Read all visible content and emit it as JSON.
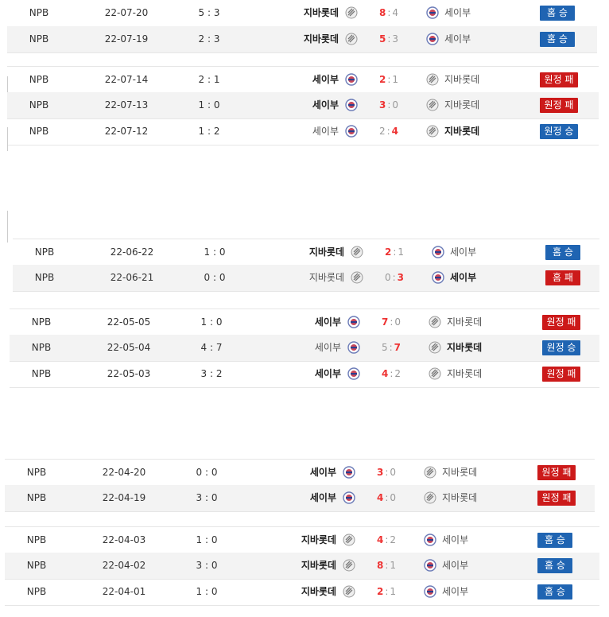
{
  "teams": {
    "lotte": "지바롯데",
    "seibu": "세이부"
  },
  "groups": [
    {
      "rows": [
        {
          "league": "NPB",
          "date": "22-07-20",
          "ht": "5 : 3",
          "home": "지바롯데",
          "away": "세이부",
          "hs": "8",
          "as": "4",
          "home_logo": "lotte",
          "away_logo": "seibu",
          "home_bold": true,
          "away_bold": false,
          "hs_win": true,
          "result": "홈 승",
          "result_kind": "home-win"
        },
        {
          "league": "NPB",
          "date": "22-07-19",
          "ht": "2 : 3",
          "home": "지바롯데",
          "away": "세이부",
          "hs": "5",
          "as": "3",
          "home_logo": "lotte",
          "away_logo": "seibu",
          "home_bold": true,
          "away_bold": false,
          "hs_win": true,
          "result": "홈 승",
          "result_kind": "home-win"
        }
      ]
    },
    {
      "rows": [
        {
          "league": "NPB",
          "date": "22-07-14",
          "ht": "2 : 1",
          "home": "세이부",
          "away": "지바롯데",
          "hs": "2",
          "as": "1",
          "home_logo": "seibu",
          "away_logo": "lotte",
          "home_bold": true,
          "away_bold": false,
          "hs_win": true,
          "result": "원정 패",
          "result_kind": "away-loss"
        },
        {
          "league": "NPB",
          "date": "22-07-13",
          "ht": "1 : 0",
          "home": "세이부",
          "away": "지바롯데",
          "hs": "3",
          "as": "0",
          "home_logo": "seibu",
          "away_logo": "lotte",
          "home_bold": true,
          "away_bold": false,
          "hs_win": true,
          "result": "원정 패",
          "result_kind": "away-loss"
        },
        {
          "league": "NPB",
          "date": "22-07-12",
          "ht": "1 : 2",
          "home": "세이부",
          "away": "지바롯데",
          "hs": "2",
          "as": "4",
          "home_logo": "seibu",
          "away_logo": "lotte",
          "home_bold": false,
          "away_bold": true,
          "hs_win": false,
          "result": "원정 승",
          "result_kind": "away-win"
        }
      ]
    },
    {
      "rows": [
        {
          "league": "NPB",
          "date": "22-06-22",
          "ht": "1 : 0",
          "home": "지바롯데",
          "away": "세이부",
          "hs": "2",
          "as": "1",
          "home_logo": "lotte",
          "away_logo": "seibu",
          "home_bold": true,
          "away_bold": false,
          "hs_win": true,
          "result": "홈 승",
          "result_kind": "home-win"
        },
        {
          "league": "NPB",
          "date": "22-06-21",
          "ht": "0 : 0",
          "home": "지바롯데",
          "away": "세이부",
          "hs": "0",
          "as": "3",
          "home_logo": "lotte",
          "away_logo": "seibu",
          "home_bold": false,
          "away_bold": true,
          "hs_win": false,
          "result": "홈 패",
          "result_kind": "home-loss"
        }
      ]
    },
    {
      "rows": [
        {
          "league": "NPB",
          "date": "22-05-05",
          "ht": "1 : 0",
          "home": "세이부",
          "away": "지바롯데",
          "hs": "7",
          "as": "0",
          "home_logo": "seibu",
          "away_logo": "lotte",
          "home_bold": true,
          "away_bold": false,
          "hs_win": true,
          "result": "원정 패",
          "result_kind": "away-loss"
        },
        {
          "league": "NPB",
          "date": "22-05-04",
          "ht": "4 : 7",
          "home": "세이부",
          "away": "지바롯데",
          "hs": "5",
          "as": "7",
          "home_logo": "seibu",
          "away_logo": "lotte",
          "home_bold": false,
          "away_bold": true,
          "hs_win": false,
          "result": "원정 승",
          "result_kind": "away-win"
        },
        {
          "league": "NPB",
          "date": "22-05-03",
          "ht": "3 : 2",
          "home": "세이부",
          "away": "지바롯데",
          "hs": "4",
          "as": "2",
          "home_logo": "seibu",
          "away_logo": "lotte",
          "home_bold": true,
          "away_bold": false,
          "hs_win": true,
          "result": "원정 패",
          "result_kind": "away-loss"
        }
      ]
    },
    {
      "rows": [
        {
          "league": "NPB",
          "date": "22-04-20",
          "ht": "0 : 0",
          "home": "세이부",
          "away": "지바롯데",
          "hs": "3",
          "as": "0",
          "home_logo": "seibu",
          "away_logo": "lotte",
          "home_bold": true,
          "away_bold": false,
          "hs_win": true,
          "result": "원정 패",
          "result_kind": "away-loss"
        },
        {
          "league": "NPB",
          "date": "22-04-19",
          "ht": "3 : 0",
          "home": "세이부",
          "away": "지바롯데",
          "hs": "4",
          "as": "0",
          "home_logo": "seibu",
          "away_logo": "lotte",
          "home_bold": true,
          "away_bold": false,
          "hs_win": true,
          "result": "원정 패",
          "result_kind": "away-loss"
        }
      ]
    },
    {
      "rows": [
        {
          "league": "NPB",
          "date": "22-04-03",
          "ht": "1 : 0",
          "home": "지바롯데",
          "away": "세이부",
          "hs": "4",
          "as": "2",
          "home_logo": "lotte",
          "away_logo": "seibu",
          "home_bold": true,
          "away_bold": false,
          "hs_win": true,
          "result": "홈 승",
          "result_kind": "home-win"
        },
        {
          "league": "NPB",
          "date": "22-04-02",
          "ht": "3 : 0",
          "home": "지바롯데",
          "away": "세이부",
          "hs": "8",
          "as": "1",
          "home_logo": "lotte",
          "away_logo": "seibu",
          "home_bold": true,
          "away_bold": false,
          "hs_win": true,
          "result": "홈 승",
          "result_kind": "home-win"
        },
        {
          "league": "NPB",
          "date": "22-04-01",
          "ht": "1 : 0",
          "home": "지바롯데",
          "away": "세이부",
          "hs": "2",
          "as": "1",
          "home_logo": "lotte",
          "away_logo": "seibu",
          "home_bold": true,
          "away_bold": false,
          "hs_win": true,
          "result": "홈 승",
          "result_kind": "home-win"
        }
      ]
    }
  ],
  "colors": {
    "win_score": "#ee3333",
    "home_win_badge": "#1f64b2",
    "loss_badge": "#cc1a1a"
  }
}
